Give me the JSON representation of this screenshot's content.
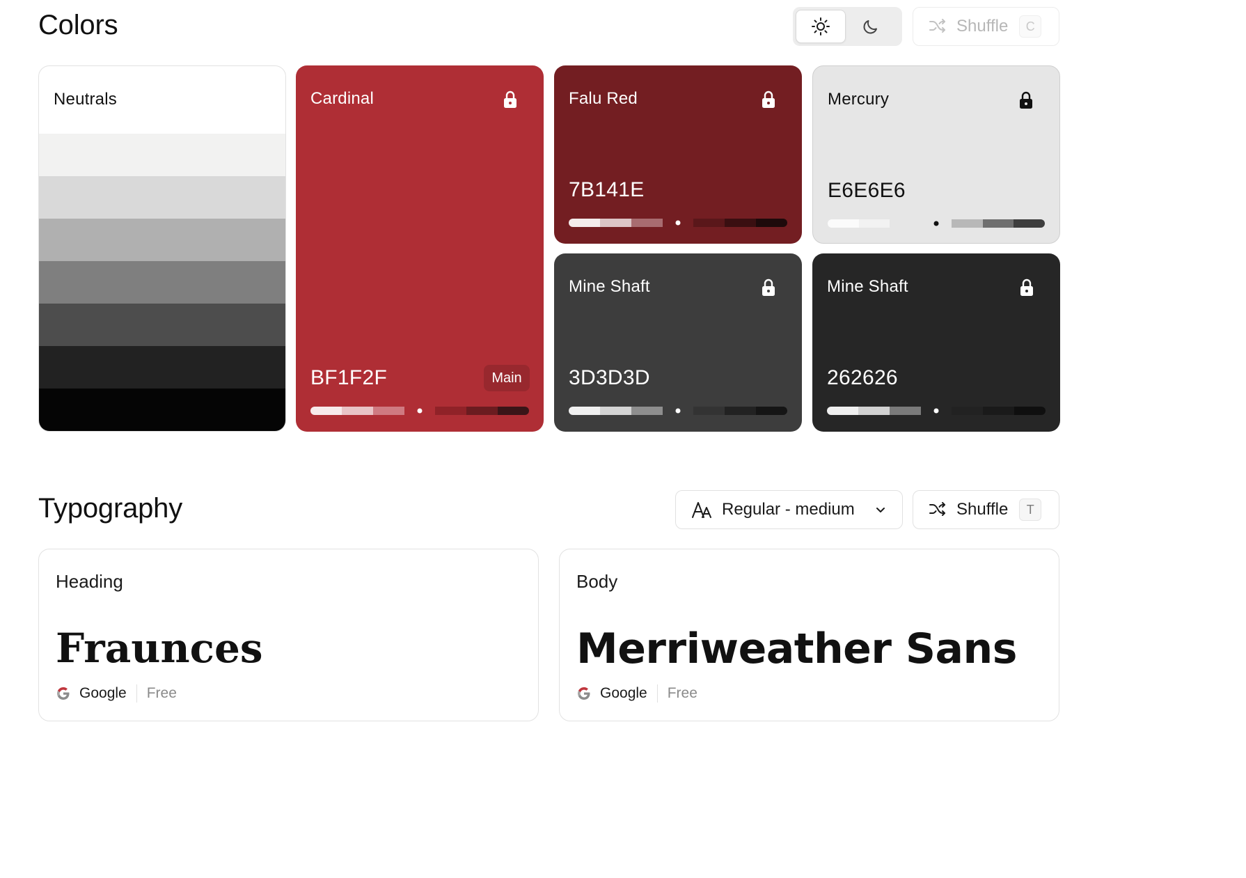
{
  "colors_section": {
    "title": "Colors",
    "mode_toggle": {
      "light_icon": "sun-icon",
      "dark_icon": "moon-icon",
      "selected": "light"
    },
    "shuffle": {
      "label": "Shuffle",
      "shortcut": "C",
      "enabled": false
    }
  },
  "palette": {
    "neutrals": {
      "name": "Neutrals",
      "shades": [
        "#f2f2f1",
        "#d9d9d9",
        "#b0b0b0",
        "#7f7f7f",
        "#4d4d4d",
        "#222222",
        "#050505"
      ]
    },
    "cards": [
      {
        "name": "Cardinal",
        "hex": "BF1F2F",
        "color": "#af2e35",
        "text_color": "#ffffff",
        "locked": true,
        "badge": "Main",
        "scale": [
          "#f7eaeb",
          "#e9c3c6",
          "#cf7a81",
          "#af2e35",
          "#902228",
          "#6b1c20",
          "#3a1518"
        ],
        "dot_index": 3
      },
      {
        "name": "Falu Red",
        "hex": "7B141E",
        "color": "#731e22",
        "text_color": "#ffffff",
        "locked": true,
        "scale": [
          "#f4ecec",
          "#dcc5c6",
          "#a86c70",
          "#731e22",
          "#5a171a",
          "#3a0f11",
          "#1e0a0b"
        ],
        "dot_index": 3
      },
      {
        "name": "Mercury",
        "hex": "E6E6E6",
        "color": "#e6e6e6",
        "text_color": "#111111",
        "locked": true,
        "scale": [
          "#fbfbfb",
          "#f2f2f2",
          "#e6e6e6",
          "#e6e6e6",
          "#b8b8b8",
          "#6f6f6f",
          "#3e3e3e"
        ],
        "dot_index": 3
      },
      {
        "name": "Mine Shaft",
        "hex": "3D3D3D",
        "color": "#3d3d3d",
        "text_color": "#ffffff",
        "locked": true,
        "scale": [
          "#f0f0f0",
          "#d4d4d4",
          "#8e8e8e",
          "#3d3d3d",
          "#333333",
          "#222222",
          "#151515"
        ],
        "dot_index": 3
      },
      {
        "name": "Mine Shaft",
        "hex": "262626",
        "color": "#262626",
        "text_color": "#ffffff",
        "locked": true,
        "scale": [
          "#efefef",
          "#d1d1d1",
          "#7a7a7a",
          "#262626",
          "#222222",
          "#1a1a1a",
          "#0f0f0f"
        ],
        "dot_index": 3
      }
    ]
  },
  "typography_section": {
    "title": "Typography",
    "font_select": {
      "icon": "font-icon",
      "value": "Regular - medium"
    },
    "shuffle": {
      "label": "Shuffle",
      "shortcut": "T",
      "enabled": true
    }
  },
  "fonts": {
    "heading": {
      "label": "Heading",
      "family": "Fraunces",
      "provider": "Google",
      "price": "Free"
    },
    "body": {
      "label": "Body",
      "family": "Merriweather Sans",
      "provider": "Google",
      "price": "Free"
    }
  }
}
